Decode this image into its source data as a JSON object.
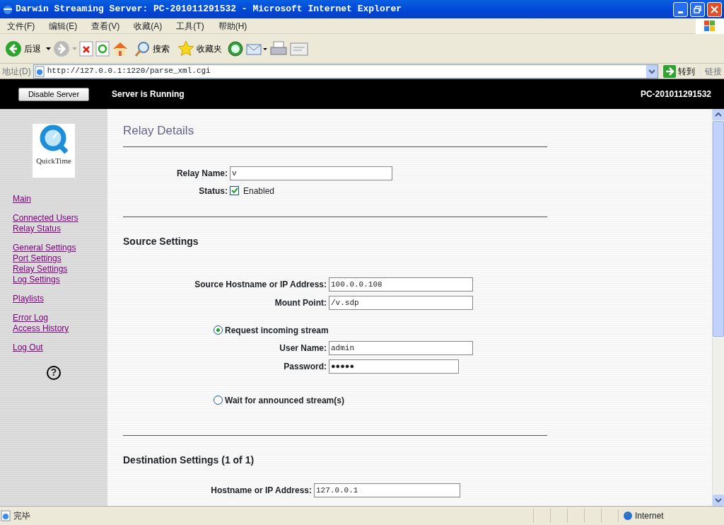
{
  "window": {
    "title": "Darwin Streaming Server: PC-201011291532 - Microsoft Internet Explorer"
  },
  "menu": [
    "文件(F)",
    "编辑(E)",
    "查看(V)",
    "收藏(A)",
    "工具(T)",
    "帮助(H)"
  ],
  "toolbar": {
    "back": "后退",
    "search": "搜索",
    "favorites": "收藏夹"
  },
  "address_bar": {
    "label": "地址(D)",
    "value": "http://127.0.0.1:1220/parse_xml.cgi",
    "go": "转到",
    "links": "链接"
  },
  "header": {
    "button": "Disable Server",
    "status": "Server is Running",
    "host": "PC-201011291532"
  },
  "sidebar": {
    "logo_text": "QuickTime",
    "groups": [
      [
        "Main"
      ],
      [
        "Connected Users",
        "Relay Status"
      ],
      [
        "General Settings",
        "Port Settings",
        "Relay Settings",
        "Log Settings"
      ],
      [
        "Playlists"
      ],
      [
        "Error Log",
        "Access History"
      ],
      [
        "Log Out"
      ]
    ],
    "help_symbol": "?"
  },
  "content": {
    "title": "Relay Details",
    "sections": [
      {
        "rows": [
          {
            "kind": "text",
            "label": "Relay Name:",
            "value": "v"
          },
          {
            "kind": "checkbox",
            "label": "Status:",
            "text": "Enabled",
            "checked": true
          }
        ]
      },
      {
        "heading": "Source Settings",
        "rows": [
          {
            "kind": "text",
            "label": "Source Hostname or IP Address:",
            "value": "100.0.0.108"
          },
          {
            "kind": "text",
            "label": "Mount Point:",
            "value": "/v.sdp"
          },
          {
            "kind": "radio",
            "text": "Request incoming stream",
            "selected": true
          },
          {
            "kind": "text",
            "label": "User Name:",
            "value": "admin"
          },
          {
            "kind": "password",
            "label": "Password:",
            "value": "●●●●●"
          },
          {
            "kind": "radio",
            "text": "Wait for announced stream(s)",
            "selected": false
          }
        ]
      },
      {
        "heading": "Destination Settings (1 of 1)",
        "rows": [
          {
            "kind": "text",
            "label": "Hostname or IP Address:",
            "value": "127.0.0.1"
          }
        ]
      }
    ]
  },
  "status_bar": {
    "text": "完毕",
    "zone": "Internet"
  }
}
